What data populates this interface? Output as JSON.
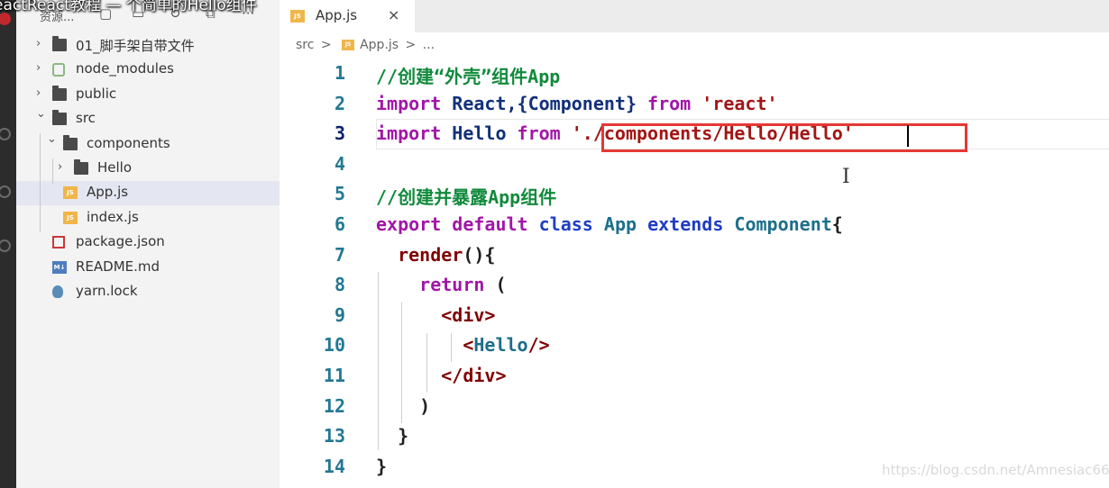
{
  "video_title": "ReactReact教程 — 个简单的Hello组件",
  "sidebar": {
    "title": "资源...",
    "header_icons": [
      "new-file-icon",
      "new-folder-icon",
      "refresh-icon",
      "collapse-all-icon",
      "more-icon"
    ],
    "more_glyph": "···",
    "tree": [
      {
        "label": "01_脚手架自带文件",
        "kind": "folder",
        "expanded": false
      },
      {
        "label": "node_modules",
        "kind": "nodejs-folder",
        "expanded": false
      },
      {
        "label": "public",
        "kind": "folder",
        "expanded": false
      },
      {
        "label": "src",
        "kind": "folder",
        "expanded": true
      },
      {
        "label": "components",
        "kind": "folder",
        "expanded": true
      },
      {
        "label": "Hello",
        "kind": "folder",
        "expanded": false
      },
      {
        "label": "App.js",
        "kind": "js",
        "selected": true
      },
      {
        "label": "index.js",
        "kind": "js"
      },
      {
        "label": "package.json",
        "kind": "npm"
      },
      {
        "label": "README.md",
        "kind": "markdown"
      },
      {
        "label": "yarn.lock",
        "kind": "yarn"
      }
    ]
  },
  "tab": {
    "label": "App.js",
    "close": "×",
    "icon_text": "JS"
  },
  "breadcrumb": {
    "parts": [
      "src",
      ">",
      "App.js",
      ">",
      "..."
    ]
  },
  "editor": {
    "current_line": 3,
    "lines": [
      {
        "num": "1",
        "tokens": [
          {
            "t": "//创建“外壳”组件App",
            "c": "cmt"
          }
        ]
      },
      {
        "num": "2",
        "tokens": [
          {
            "t": "import",
            "c": "kw"
          },
          {
            "t": " React,{Component} ",
            "c": "var"
          },
          {
            "t": "from",
            "c": "kw"
          },
          {
            "t": " ",
            "c": ""
          },
          {
            "t": "'react'",
            "c": "str"
          }
        ]
      },
      {
        "num": "3",
        "tokens": [
          {
            "t": "import",
            "c": "kw"
          },
          {
            "t": " Hello ",
            "c": "var"
          },
          {
            "t": "from",
            "c": "kw"
          },
          {
            "t": " ",
            "c": ""
          },
          {
            "t": "'./components/Hello/Hello'",
            "c": "str"
          }
        ]
      },
      {
        "num": "4",
        "tokens": []
      },
      {
        "num": "5",
        "tokens": [
          {
            "t": "//创建并暴露App组件",
            "c": "cmt"
          }
        ]
      },
      {
        "num": "6",
        "tokens": [
          {
            "t": "export",
            "c": "kw"
          },
          {
            "t": " ",
            "c": ""
          },
          {
            "t": "default",
            "c": "kw"
          },
          {
            "t": " ",
            "c": ""
          },
          {
            "t": "class",
            "c": "blue"
          },
          {
            "t": " ",
            "c": ""
          },
          {
            "t": "App",
            "c": "cls"
          },
          {
            "t": " ",
            "c": ""
          },
          {
            "t": "extends",
            "c": "blue"
          },
          {
            "t": " ",
            "c": ""
          },
          {
            "t": "Component",
            "c": "cls"
          },
          {
            "t": "{",
            "c": ""
          }
        ]
      },
      {
        "num": "7",
        "tokens": [
          {
            "t": "  render",
            "c": "tag"
          },
          {
            "t": "(){",
            "c": ""
          }
        ]
      },
      {
        "num": "8",
        "tokens": [
          {
            "t": "    ",
            "c": ""
          },
          {
            "t": "return",
            "c": "kw"
          },
          {
            "t": " (",
            "c": ""
          }
        ]
      },
      {
        "num": "9",
        "tokens": [
          {
            "t": "      <",
            "c": "tag"
          },
          {
            "t": "div",
            "c": "tag"
          },
          {
            "t": ">",
            "c": "tag"
          }
        ]
      },
      {
        "num": "10",
        "tokens": [
          {
            "t": "        <",
            "c": "tag"
          },
          {
            "t": "Hello",
            "c": "cmp"
          },
          {
            "t": "/>",
            "c": "tag"
          }
        ]
      },
      {
        "num": "11",
        "tokens": [
          {
            "t": "      </",
            "c": "tag"
          },
          {
            "t": "div",
            "c": "tag"
          },
          {
            "t": ">",
            "c": "tag"
          }
        ]
      },
      {
        "num": "12",
        "tokens": [
          {
            "t": "    )",
            "c": ""
          }
        ]
      },
      {
        "num": "13",
        "tokens": [
          {
            "t": "  }",
            "c": ""
          }
        ]
      },
      {
        "num": "14",
        "tokens": [
          {
            "t": "}",
            "c": ""
          }
        ]
      }
    ]
  },
  "watermark": "https://blog.csdn.net/Amnesiac666"
}
